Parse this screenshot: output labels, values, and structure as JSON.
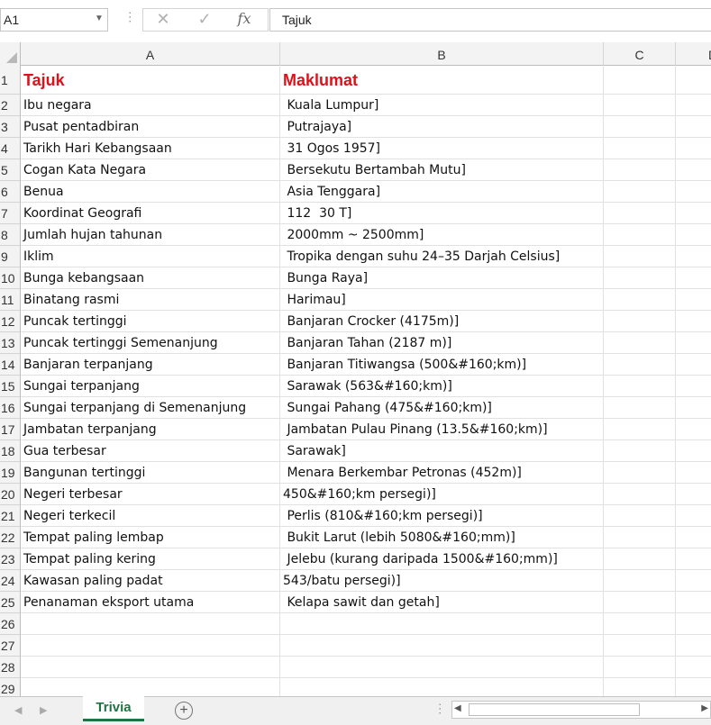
{
  "formula_bar": {
    "name_box": "A1",
    "cancel_icon": "✕",
    "enter_icon": "✓",
    "fx_label": "fx",
    "formula_value": "Tajuk"
  },
  "columns": [
    "A",
    "B",
    "C",
    "D"
  ],
  "rows": [
    {
      "n": "1",
      "a": "Tajuk",
      "b": "Maklumat"
    },
    {
      "n": "2",
      "a": "Ibu negara",
      "b": " Kuala Lumpur]"
    },
    {
      "n": "3",
      "a": "Pusat pentadbiran",
      "b": " Putrajaya]"
    },
    {
      "n": "4",
      "a": "Tarikh Hari Kebangsaan",
      "b": " 31 Ogos 1957]"
    },
    {
      "n": "5",
      "a": "Cogan Kata Negara",
      "b": " Bersekutu Bertambah Mutu]"
    },
    {
      "n": "6",
      "a": "Benua",
      "b": " Asia Tenggara]"
    },
    {
      "n": "7",
      "a": "Koordinat Geografi",
      "b": " 112  30 T]"
    },
    {
      "n": "8",
      "a": "Jumlah hujan tahunan",
      "b": " 2000mm ~ 2500mm]"
    },
    {
      "n": "9",
      "a": "Iklim",
      "b": " Tropika dengan suhu 24–35 Darjah Celsius]"
    },
    {
      "n": "10",
      "a": "Bunga kebangsaan",
      "b": " Bunga Raya]"
    },
    {
      "n": "11",
      "a": "Binatang rasmi",
      "b": " Harimau]"
    },
    {
      "n": "12",
      "a": "Puncak tertinggi",
      "b": " Banjaran Crocker (4175m)]"
    },
    {
      "n": "13",
      "a": "Puncak tertinggi Semenanjung",
      "b": " Banjaran Tahan (2187 m)]"
    },
    {
      "n": "14",
      "a": "Banjaran terpanjang",
      "b": " Banjaran Titiwangsa (500&#160;km)]"
    },
    {
      "n": "15",
      "a": "Sungai terpanjang",
      "b": " Sarawak (563&#160;km)]"
    },
    {
      "n": "16",
      "a": "Sungai terpanjang di Semenanjung",
      "b": " Sungai Pahang (475&#160;km)]"
    },
    {
      "n": "17",
      "a": "Jambatan terpanjang",
      "b": " Jambatan Pulau Pinang (13.5&#160;km)]"
    },
    {
      "n": "18",
      "a": "Gua terbesar",
      "b": " Sarawak]"
    },
    {
      "n": "19",
      "a": "Bangunan tertinggi",
      "b": " Menara Berkembar Petronas (452m)]"
    },
    {
      "n": "20",
      "a": "Negeri terbesar",
      "b": "450&#160;km persegi)]"
    },
    {
      "n": "21",
      "a": "Negeri terkecil",
      "b": " Perlis (810&#160;km persegi)]"
    },
    {
      "n": "22",
      "a": "Tempat paling lembap",
      "b": " Bukit Larut (lebih 5080&#160;mm)]"
    },
    {
      "n": "23",
      "a": "Tempat paling kering",
      "b": " Jelebu (kurang daripada 1500&#160;mm)]"
    },
    {
      "n": "24",
      "a": "Kawasan paling padat",
      "b": "543/batu persegi)]"
    },
    {
      "n": "25",
      "a": "Penanaman eksport utama",
      "b": " Kelapa sawit dan getah]"
    },
    {
      "n": "26",
      "a": "",
      "b": ""
    },
    {
      "n": "27",
      "a": "",
      "b": ""
    },
    {
      "n": "28",
      "a": "",
      "b": ""
    },
    {
      "n": "29",
      "a": "",
      "b": ""
    }
  ],
  "sheet_tabs": [
    "Trivia"
  ],
  "add_sheet_icon": "+",
  "colors": {
    "header_red": "#e0101a",
    "tab_green": "#217346"
  }
}
